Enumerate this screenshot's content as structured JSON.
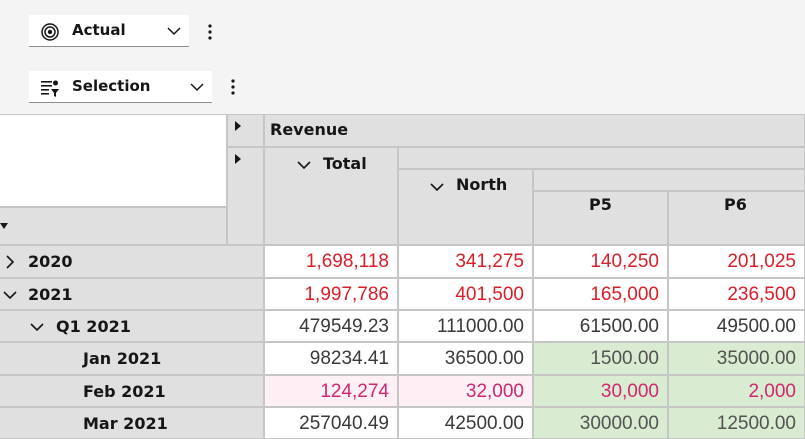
{
  "toolbar1": {
    "dropdown_label": "Actual",
    "icon": "target-icon"
  },
  "toolbar2": {
    "dropdown_label": "Selection",
    "icon": "filter-list-icon"
  },
  "headers": {
    "measure": "Revenue",
    "total": "Total",
    "north": "North",
    "periods": [
      "P5",
      "P6"
    ]
  },
  "rows": [
    {
      "label": "2020",
      "expander": "collapsed",
      "total": "1,698,118",
      "north": "341,275",
      "p5": "140,250",
      "p6": "201,025"
    },
    {
      "label": "2021",
      "expander": "expanded",
      "total": "1,997,786",
      "north": "401,500",
      "p5": "165,000",
      "p6": "236,500"
    },
    {
      "label": "Q1 2021",
      "expander": "expanded",
      "total": "479549.23",
      "north": "111000.00",
      "p5": "61500.00",
      "p6": "49500.00"
    },
    {
      "label": "Jan 2021",
      "expander": "none",
      "total": "98234.41",
      "north": "36500.00",
      "p5": "1500.00",
      "p6": "35000.00"
    },
    {
      "label": "Feb 2021",
      "expander": "none",
      "total": "124,274",
      "north": "32,000",
      "p5": "30,000",
      "p6": "2,000"
    },
    {
      "label": "Mar 2021",
      "expander": "none",
      "total": "257040.49",
      "north": "42500.00",
      "p5": "30000.00",
      "p6": "12500.00"
    }
  ],
  "colors": {
    "red": "#da1e28",
    "pink": "#d12771",
    "green_cell": "#d9ecd1",
    "pink_cell": "#fff0f6",
    "header": "#e0e0e0"
  }
}
